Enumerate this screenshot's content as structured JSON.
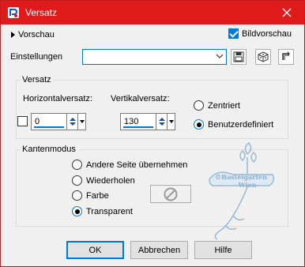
{
  "window": {
    "title": "Versatz",
    "close_icon": "close-icon",
    "app_icon": "psp-app-icon"
  },
  "toolbar": {
    "preview_toggle_label": "Vorschau",
    "image_preview_label": "Bildvorschau",
    "image_preview_checked": true,
    "settings_label": "Einstellungen",
    "settings_value": "",
    "icons": [
      "save-preset-icon",
      "randomize-dice-icon",
      "reset-icon"
    ]
  },
  "offset_group": {
    "title": "Versatz",
    "horizontal_label": "Horizontalversatz:",
    "horizontal_value": "0",
    "vertical_label": "Vertikalversatz:",
    "vertical_value": "130",
    "centered_label": "Zentriert",
    "custom_label": "Benutzerdefiniert",
    "selected": "custom"
  },
  "edge_group": {
    "title": "Kantenmodus",
    "options": [
      "Andere Seite übernehmen",
      "Wiederholen",
      "Farbe",
      "Transparent"
    ],
    "selected": "Transparent"
  },
  "watermark": {
    "line1": "©Bastelgarten",
    "line2": "Wien"
  },
  "buttons": {
    "ok": "OK",
    "cancel": "Abbrechen",
    "help": "Hilfe"
  },
  "colors": {
    "titlebar": "#e01b1b",
    "accent": "#0078d7",
    "background": "#f0f0f0"
  }
}
